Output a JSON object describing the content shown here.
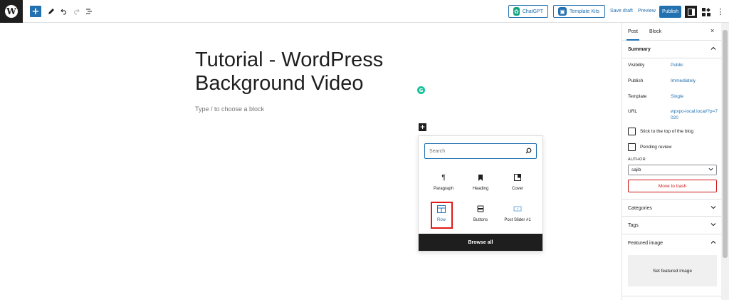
{
  "topbar": {
    "logo": "W",
    "add_icon": "+",
    "chatgpt_label": "ChatGPT",
    "template_kits_label": "Template Kits",
    "save_draft_label": "Save draft",
    "preview_label": "Preview",
    "publish_label": "Publish",
    "more_icon": "⋮",
    "accent_color": "#2271b1"
  },
  "editor": {
    "title": "Tutorial - WordPress Background Video",
    "placeholder": "Type / to choose a block",
    "grammarly_icon": "G",
    "inserter_toggle": "+"
  },
  "inserter": {
    "search_placeholder": "Search",
    "blocks": [
      {
        "label": "Paragraph",
        "icon": "¶"
      },
      {
        "label": "Heading",
        "icon": "🔖"
      },
      {
        "label": "Cover",
        "icon": "◪"
      },
      {
        "label": "Row",
        "icon": "▤"
      },
      {
        "label": "Buttons",
        "icon": "▭"
      },
      {
        "label": "Post Slider #1",
        "icon": "▭"
      }
    ],
    "browse_all_label": "Browse all",
    "highlight_color": "#e0191a"
  },
  "sidebar": {
    "tabs": [
      {
        "label": "Post"
      },
      {
        "label": "Block"
      }
    ],
    "close_icon": "×",
    "summary": {
      "title": "Summary",
      "rows": [
        {
          "key": "Visibility",
          "value": "Public"
        },
        {
          "key": "Publish",
          "value": "Immediately"
        },
        {
          "key": "Template",
          "value": "Single"
        },
        {
          "key": "URL",
          "value": "wpxpo-local.local/?p=7020"
        }
      ],
      "stick_label": "Stick to the top of the blog",
      "pending_label": "Pending review",
      "author_label": "AUTHOR",
      "author_value": "sajib",
      "move_to_trash_label": "Move to trash"
    },
    "categories_label": "Categories",
    "tags_label": "Tags",
    "featured_image_label": "Featured image",
    "set_featured_label": "Set featured image",
    "trash_color": "#cc1818"
  }
}
